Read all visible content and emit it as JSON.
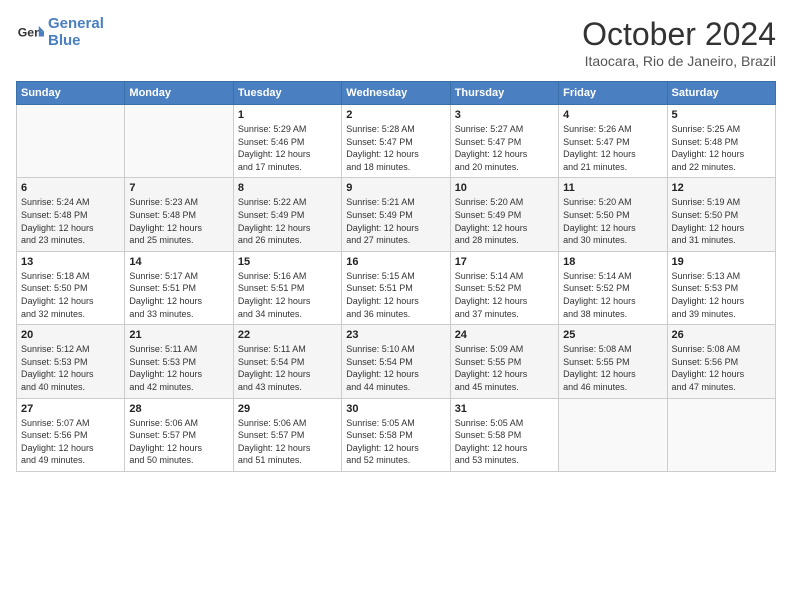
{
  "header": {
    "logo_line1": "General",
    "logo_line2": "Blue",
    "month": "October 2024",
    "location": "Itaocara, Rio de Janeiro, Brazil"
  },
  "weekdays": [
    "Sunday",
    "Monday",
    "Tuesday",
    "Wednesday",
    "Thursday",
    "Friday",
    "Saturday"
  ],
  "weeks": [
    [
      {
        "day": "",
        "info": ""
      },
      {
        "day": "",
        "info": ""
      },
      {
        "day": "1",
        "info": "Sunrise: 5:29 AM\nSunset: 5:46 PM\nDaylight: 12 hours\nand 17 minutes."
      },
      {
        "day": "2",
        "info": "Sunrise: 5:28 AM\nSunset: 5:47 PM\nDaylight: 12 hours\nand 18 minutes."
      },
      {
        "day": "3",
        "info": "Sunrise: 5:27 AM\nSunset: 5:47 PM\nDaylight: 12 hours\nand 20 minutes."
      },
      {
        "day": "4",
        "info": "Sunrise: 5:26 AM\nSunset: 5:47 PM\nDaylight: 12 hours\nand 21 minutes."
      },
      {
        "day": "5",
        "info": "Sunrise: 5:25 AM\nSunset: 5:48 PM\nDaylight: 12 hours\nand 22 minutes."
      }
    ],
    [
      {
        "day": "6",
        "info": "Sunrise: 5:24 AM\nSunset: 5:48 PM\nDaylight: 12 hours\nand 23 minutes."
      },
      {
        "day": "7",
        "info": "Sunrise: 5:23 AM\nSunset: 5:48 PM\nDaylight: 12 hours\nand 25 minutes."
      },
      {
        "day": "8",
        "info": "Sunrise: 5:22 AM\nSunset: 5:49 PM\nDaylight: 12 hours\nand 26 minutes."
      },
      {
        "day": "9",
        "info": "Sunrise: 5:21 AM\nSunset: 5:49 PM\nDaylight: 12 hours\nand 27 minutes."
      },
      {
        "day": "10",
        "info": "Sunrise: 5:20 AM\nSunset: 5:49 PM\nDaylight: 12 hours\nand 28 minutes."
      },
      {
        "day": "11",
        "info": "Sunrise: 5:20 AM\nSunset: 5:50 PM\nDaylight: 12 hours\nand 30 minutes."
      },
      {
        "day": "12",
        "info": "Sunrise: 5:19 AM\nSunset: 5:50 PM\nDaylight: 12 hours\nand 31 minutes."
      }
    ],
    [
      {
        "day": "13",
        "info": "Sunrise: 5:18 AM\nSunset: 5:50 PM\nDaylight: 12 hours\nand 32 minutes."
      },
      {
        "day": "14",
        "info": "Sunrise: 5:17 AM\nSunset: 5:51 PM\nDaylight: 12 hours\nand 33 minutes."
      },
      {
        "day": "15",
        "info": "Sunrise: 5:16 AM\nSunset: 5:51 PM\nDaylight: 12 hours\nand 34 minutes."
      },
      {
        "day": "16",
        "info": "Sunrise: 5:15 AM\nSunset: 5:51 PM\nDaylight: 12 hours\nand 36 minutes."
      },
      {
        "day": "17",
        "info": "Sunrise: 5:14 AM\nSunset: 5:52 PM\nDaylight: 12 hours\nand 37 minutes."
      },
      {
        "day": "18",
        "info": "Sunrise: 5:14 AM\nSunset: 5:52 PM\nDaylight: 12 hours\nand 38 minutes."
      },
      {
        "day": "19",
        "info": "Sunrise: 5:13 AM\nSunset: 5:53 PM\nDaylight: 12 hours\nand 39 minutes."
      }
    ],
    [
      {
        "day": "20",
        "info": "Sunrise: 5:12 AM\nSunset: 5:53 PM\nDaylight: 12 hours\nand 40 minutes."
      },
      {
        "day": "21",
        "info": "Sunrise: 5:11 AM\nSunset: 5:53 PM\nDaylight: 12 hours\nand 42 minutes."
      },
      {
        "day": "22",
        "info": "Sunrise: 5:11 AM\nSunset: 5:54 PM\nDaylight: 12 hours\nand 43 minutes."
      },
      {
        "day": "23",
        "info": "Sunrise: 5:10 AM\nSunset: 5:54 PM\nDaylight: 12 hours\nand 44 minutes."
      },
      {
        "day": "24",
        "info": "Sunrise: 5:09 AM\nSunset: 5:55 PM\nDaylight: 12 hours\nand 45 minutes."
      },
      {
        "day": "25",
        "info": "Sunrise: 5:08 AM\nSunset: 5:55 PM\nDaylight: 12 hours\nand 46 minutes."
      },
      {
        "day": "26",
        "info": "Sunrise: 5:08 AM\nSunset: 5:56 PM\nDaylight: 12 hours\nand 47 minutes."
      }
    ],
    [
      {
        "day": "27",
        "info": "Sunrise: 5:07 AM\nSunset: 5:56 PM\nDaylight: 12 hours\nand 49 minutes."
      },
      {
        "day": "28",
        "info": "Sunrise: 5:06 AM\nSunset: 5:57 PM\nDaylight: 12 hours\nand 50 minutes."
      },
      {
        "day": "29",
        "info": "Sunrise: 5:06 AM\nSunset: 5:57 PM\nDaylight: 12 hours\nand 51 minutes."
      },
      {
        "day": "30",
        "info": "Sunrise: 5:05 AM\nSunset: 5:58 PM\nDaylight: 12 hours\nand 52 minutes."
      },
      {
        "day": "31",
        "info": "Sunrise: 5:05 AM\nSunset: 5:58 PM\nDaylight: 12 hours\nand 53 minutes."
      },
      {
        "day": "",
        "info": ""
      },
      {
        "day": "",
        "info": ""
      }
    ]
  ]
}
